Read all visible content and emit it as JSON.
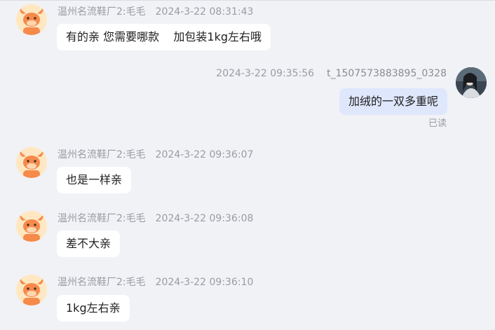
{
  "conversation": {
    "messages": [
      {
        "sender": "温州名流鞋厂2:毛毛",
        "time": "2024-3-22 08:31:43",
        "text": "有的亲 您需要哪款    加包装1kg左右哦",
        "side": "left"
      },
      {
        "sender": "t_1507573883895_0328",
        "time": "2024-3-22 09:35:56",
        "text": "加绒的一双多重呢",
        "side": "right",
        "status": "已读"
      },
      {
        "sender": "温州名流鞋厂2:毛毛",
        "time": "2024-3-22 09:36:07",
        "text": "也是一样亲",
        "side": "left"
      },
      {
        "sender": "温州名流鞋厂2:毛毛",
        "time": "2024-3-22 09:36:08",
        "text": "差不大亲",
        "side": "left"
      },
      {
        "sender": "温州名流鞋厂2:毛毛",
        "time": "2024-3-22 09:36:10",
        "text": "1kg左右亲",
        "side": "left"
      }
    ]
  },
  "icons": {
    "shop_avatar": "bull-mascot-avatar-icon",
    "user_avatar": "user-photo-avatar-icon"
  },
  "colors": {
    "background": "#f1f2f6",
    "bubble_incoming": "#ffffff",
    "bubble_outgoing": "#dfe7fd",
    "meta_text": "#9a9ca3",
    "mascot_orange": "#f58a4b"
  }
}
